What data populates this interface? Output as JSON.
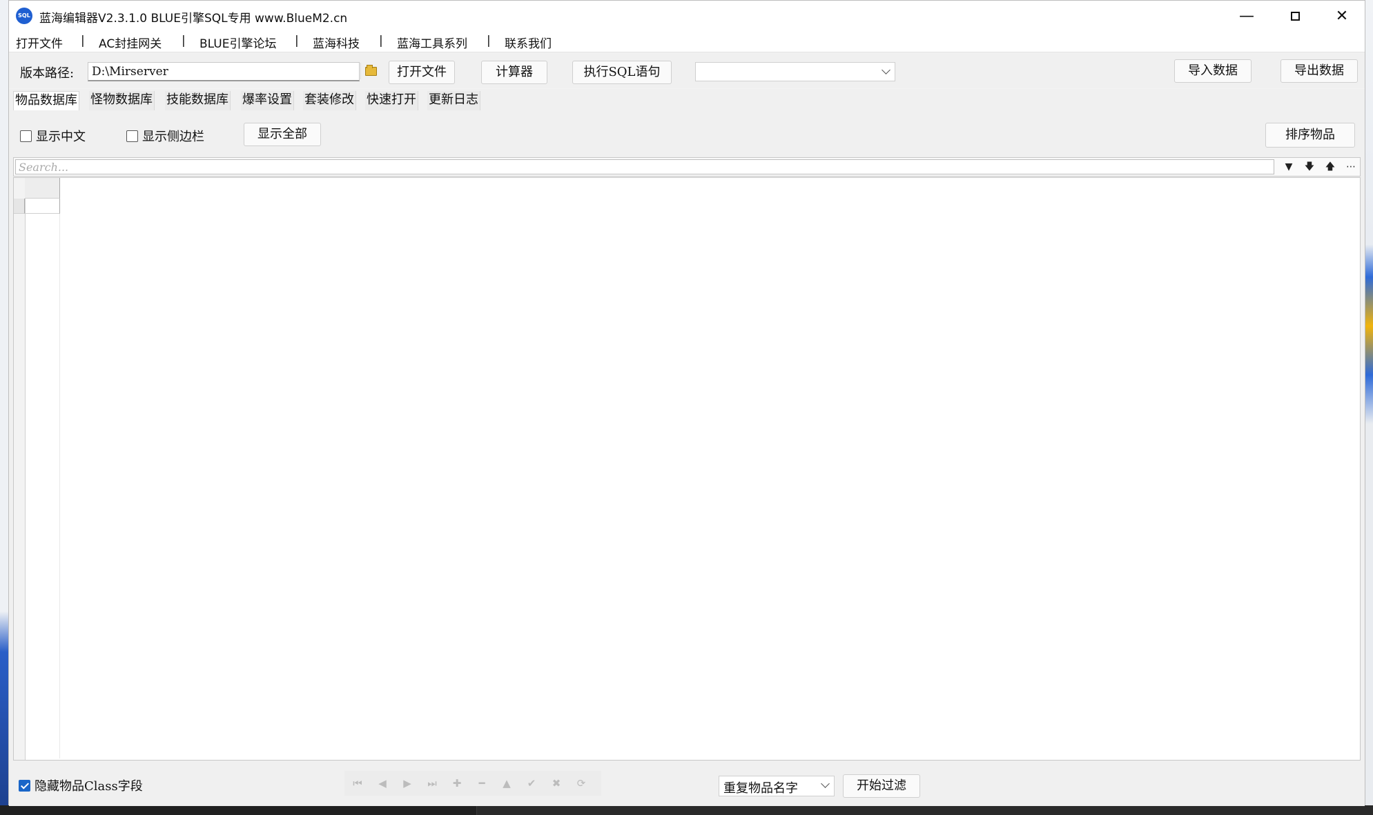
{
  "window": {
    "title": "蓝海编辑器V2.3.1.0  BLUE引擎SQL专用   www.BlueM2.cn",
    "icon_text": "SQL"
  },
  "menu": {
    "items": [
      "打开文件",
      "AC封挂网关",
      "BLUE引擎论坛",
      "蓝海科技",
      "蓝海工具系列",
      "联系我们"
    ],
    "separator": "|"
  },
  "toolbar": {
    "path_label": "版本路径:",
    "path_value": "D:\\Mirserver",
    "open_file": "打开文件",
    "calculator": "计算器",
    "exec_sql": "执行SQL语句",
    "sql_combo_value": "",
    "import": "导入数据",
    "export": "导出数据"
  },
  "tabs": [
    "物品数据库",
    "怪物数据库",
    "技能数据库",
    "爆率设置",
    "套装修改",
    "快速打开",
    "更新日志"
  ],
  "panel": {
    "show_chinese": "显示中文",
    "show_sidebar": "显示侧边栏",
    "show_all": "显示全部",
    "sort_items": "排序物品",
    "search_placeholder": "Search...",
    "hide_class": "隐藏物品Class字段",
    "hide_class_checked": true,
    "filter_combo_value": "重复物品名字",
    "start_filter": "开始过滤"
  },
  "icons": {
    "search_tools": [
      "filter-icon",
      "sort-desc-icon",
      "sort-asc-icon",
      "more-icon"
    ],
    "navigator": [
      "first-record-icon",
      "prior-record-icon",
      "next-record-icon",
      "last-record-icon",
      "insert-icon",
      "delete-icon",
      "edit-icon",
      "post-icon",
      "cancel-icon",
      "refresh-icon"
    ]
  },
  "colors": {
    "accent": "#1a66c8",
    "window_bg": "#f3f3f3"
  }
}
